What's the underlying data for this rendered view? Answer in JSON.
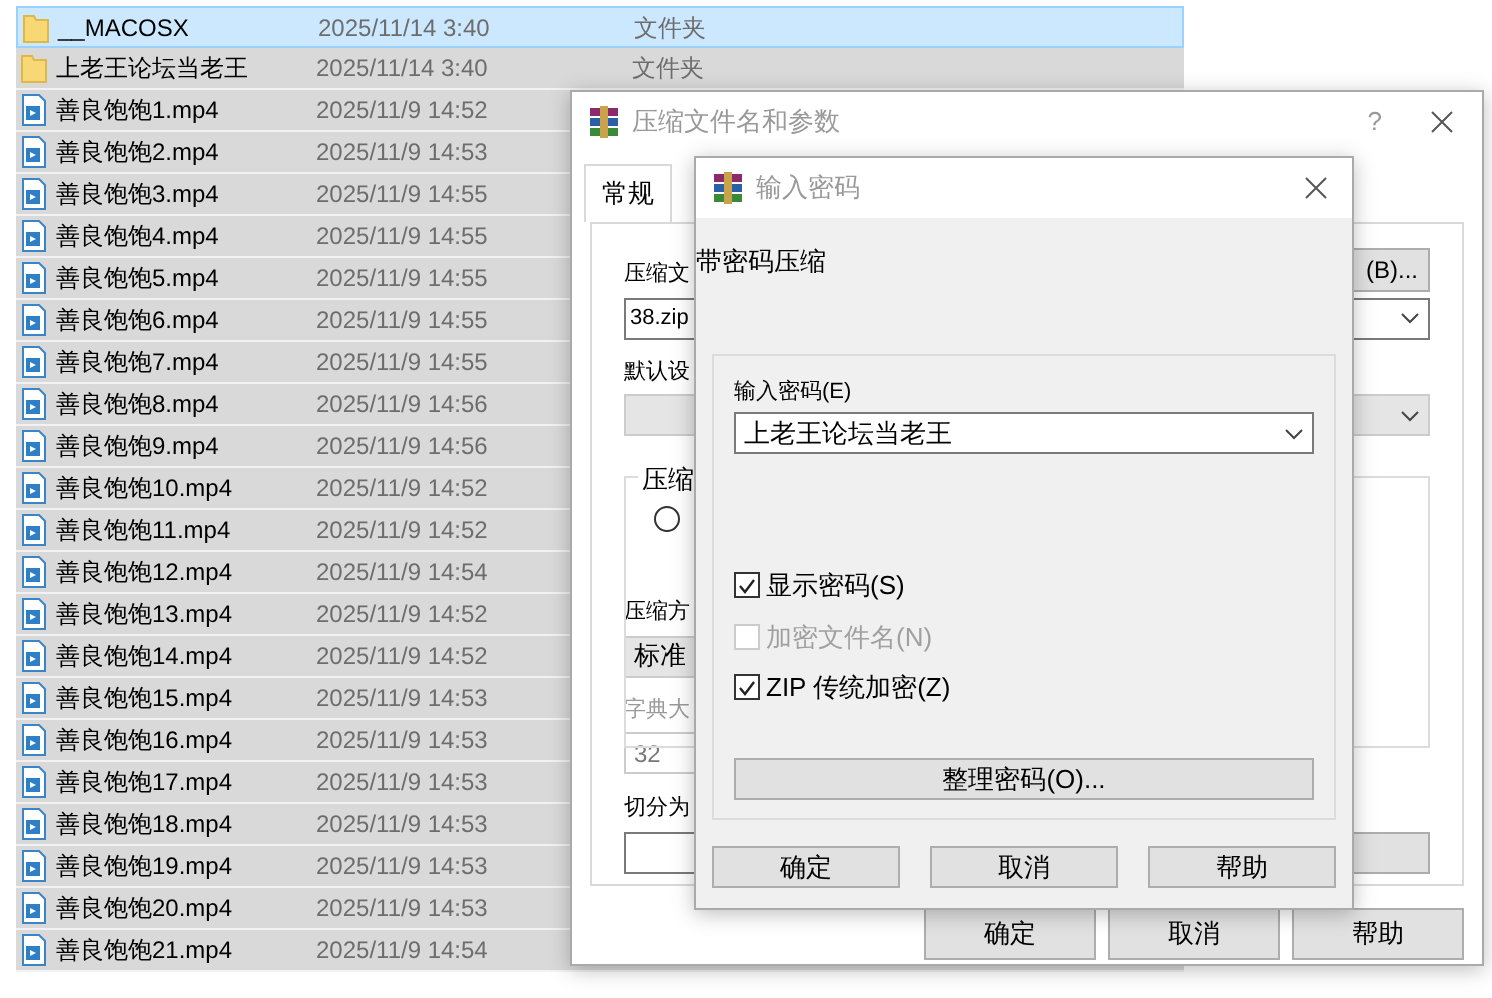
{
  "file_list": {
    "rows": [
      {
        "kind": "folder",
        "name": "__MACOSX",
        "date": "2025/11/14 3:40",
        "type": "文件夹",
        "selected": true,
        "focused": true
      },
      {
        "kind": "folder",
        "name": "上老王论坛当老王",
        "date": "2025/11/14 3:40",
        "type": "文件夹",
        "selected": true,
        "focused": false
      },
      {
        "kind": "video",
        "name": "善良饱饱1.mp4",
        "date": "2025/11/9 14:52",
        "selected": true,
        "focused": false
      },
      {
        "kind": "video",
        "name": "善良饱饱2.mp4",
        "date": "2025/11/9 14:53",
        "selected": true,
        "focused": false
      },
      {
        "kind": "video",
        "name": "善良饱饱3.mp4",
        "date": "2025/11/9 14:55",
        "selected": true,
        "focused": false
      },
      {
        "kind": "video",
        "name": "善良饱饱4.mp4",
        "date": "2025/11/9 14:55",
        "selected": true,
        "focused": false
      },
      {
        "kind": "video",
        "name": "善良饱饱5.mp4",
        "date": "2025/11/9 14:55",
        "selected": true,
        "focused": false
      },
      {
        "kind": "video",
        "name": "善良饱饱6.mp4",
        "date": "2025/11/9 14:55",
        "selected": true,
        "focused": false
      },
      {
        "kind": "video",
        "name": "善良饱饱7.mp4",
        "date": "2025/11/9 14:55",
        "selected": true,
        "focused": false
      },
      {
        "kind": "video",
        "name": "善良饱饱8.mp4",
        "date": "2025/11/9 14:56",
        "selected": true,
        "focused": false
      },
      {
        "kind": "video",
        "name": "善良饱饱9.mp4",
        "date": "2025/11/9 14:56",
        "selected": true,
        "focused": false
      },
      {
        "kind": "video",
        "name": "善良饱饱10.mp4",
        "date": "2025/11/9 14:52",
        "selected": true,
        "focused": false
      },
      {
        "kind": "video",
        "name": "善良饱饱11.mp4",
        "date": "2025/11/9 14:52",
        "selected": true,
        "focused": false
      },
      {
        "kind": "video",
        "name": "善良饱饱12.mp4",
        "date": "2025/11/9 14:54",
        "selected": true,
        "focused": false
      },
      {
        "kind": "video",
        "name": "善良饱饱13.mp4",
        "date": "2025/11/9 14:52",
        "selected": true,
        "focused": false
      },
      {
        "kind": "video",
        "name": "善良饱饱14.mp4",
        "date": "2025/11/9 14:52",
        "selected": true,
        "focused": false
      },
      {
        "kind": "video",
        "name": "善良饱饱15.mp4",
        "date": "2025/11/9 14:53",
        "selected": true,
        "focused": false
      },
      {
        "kind": "video",
        "name": "善良饱饱16.mp4",
        "date": "2025/11/9 14:53",
        "selected": true,
        "focused": false
      },
      {
        "kind": "video",
        "name": "善良饱饱17.mp4",
        "date": "2025/11/9 14:53",
        "selected": true,
        "focused": false
      },
      {
        "kind": "video",
        "name": "善良饱饱18.mp4",
        "date": "2025/11/9 14:53",
        "selected": true,
        "focused": false
      },
      {
        "kind": "video",
        "name": "善良饱饱19.mp4",
        "date": "2025/11/9 14:53",
        "selected": true,
        "focused": false
      },
      {
        "kind": "video",
        "name": "善良饱饱20.mp4",
        "date": "2025/11/9 14:53",
        "selected": true,
        "focused": false
      },
      {
        "kind": "video",
        "name": "善良饱饱21.mp4",
        "date": "2025/11/9 14:54",
        "selected": true,
        "focused": false
      }
    ]
  },
  "archive_dialog": {
    "title": "压缩文件名和参数",
    "help": "?",
    "tabs": [
      {
        "label": "常规",
        "selected": true
      }
    ],
    "archive_name_label": "压缩文",
    "archive_name": "38.zip",
    "browse_button": "(B)...",
    "profile_label": "默认设",
    "format_group_label": "压缩",
    "format_radio_selected": false,
    "method_label": "压缩方",
    "method": "标准",
    "dictionary_label": "字典大",
    "dictionary": "32",
    "dictionary_disabled": true,
    "split_label": "切分为",
    "buttons": [
      "确定",
      "取消",
      "帮助"
    ]
  },
  "password_dialog": {
    "title": "输入密码",
    "heading": "带密码压缩",
    "password_label": "输入密码(E)",
    "password": "上老王论坛当老王",
    "options": [
      {
        "label": "显示密码(S)",
        "checked": true,
        "disabled": false
      },
      {
        "label": "加密文件名(N)",
        "checked": false,
        "disabled": true
      },
      {
        "label": "ZIP 传统加密(Z)",
        "checked": true,
        "disabled": false
      }
    ],
    "organize_button": "整理密码(O)...",
    "buttons": [
      "确定",
      "取消",
      "帮助"
    ]
  }
}
